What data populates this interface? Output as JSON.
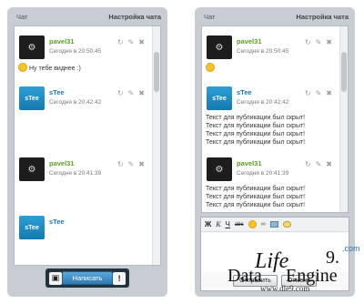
{
  "left_panel": {
    "header": {
      "chat": "Чат",
      "settings": "Настройка чата"
    },
    "messages": [
      {
        "author": "pavel31",
        "time": "Сегодня в 20:50:45",
        "avatar_icon": "gears-icon",
        "text": "Ну тебе виднее :)",
        "has_smiley": true
      },
      {
        "author": "sTee",
        "time": "Сегодня в 20:42:42",
        "avatar_icon": "stee-logo-icon",
        "text": ""
      },
      {
        "author": "pavel31",
        "time": "Сегодня в 20:41:39",
        "avatar_icon": "gears-icon",
        "text": ""
      },
      {
        "author": "sTee",
        "time": "",
        "avatar_icon": "stee-logo-icon",
        "text": ""
      }
    ],
    "bottom_bar": {
      "send_label": "Написать",
      "left_icon": "gift-icon",
      "right_icon": "alert-icon",
      "alert_glyph": "!"
    }
  },
  "right_panel": {
    "header": {
      "chat": "Чат",
      "settings": "Настройка чата"
    },
    "messages": [
      {
        "author": "pavel31",
        "time": "Сегодня в 20:50:45",
        "avatar_icon": "gears-icon",
        "text": "",
        "smiley_only": true
      },
      {
        "author": "sTee",
        "time": "Сегодня в 20:42:42",
        "avatar_icon": "stee-logo-icon",
        "lines": [
          "Текст для публикации был скрыт!",
          "Текст для публикации был скрыт!",
          "Текст для публикации был скрыт!",
          "Текст для публикации был скрыт!"
        ]
      },
      {
        "author": "pavel31",
        "time": "Сегодня в 20:41:39",
        "avatar_icon": "gears-icon",
        "lines": [
          "Текст для публикации был скрыт!",
          "Текст для публикации был скрыт!",
          "Текст для публикации был скрыт!"
        ]
      },
      {
        "author": "sTee",
        "time": "",
        "avatar_icon": "stee-logo-icon"
      }
    ],
    "editor": {
      "toolbar": {
        "bold": "Ж",
        "italic": "К",
        "underline": "Ч",
        "strike": "abc"
      },
      "send_label": "Отправить",
      "cancel_label": "Отмена"
    }
  },
  "watermark": {
    "data": "Data",
    "life": "Life",
    "engine": "Engine",
    "version": "9.",
    "com": ".com",
    "url": "www.dle9.com"
  },
  "colors": {
    "panel_bg": "#c7cdd3",
    "author_green": "#5a9c23",
    "author_blue": "#1a75b8",
    "send_button": "#2d7ab4",
    "bar_dark": "#23323f"
  }
}
